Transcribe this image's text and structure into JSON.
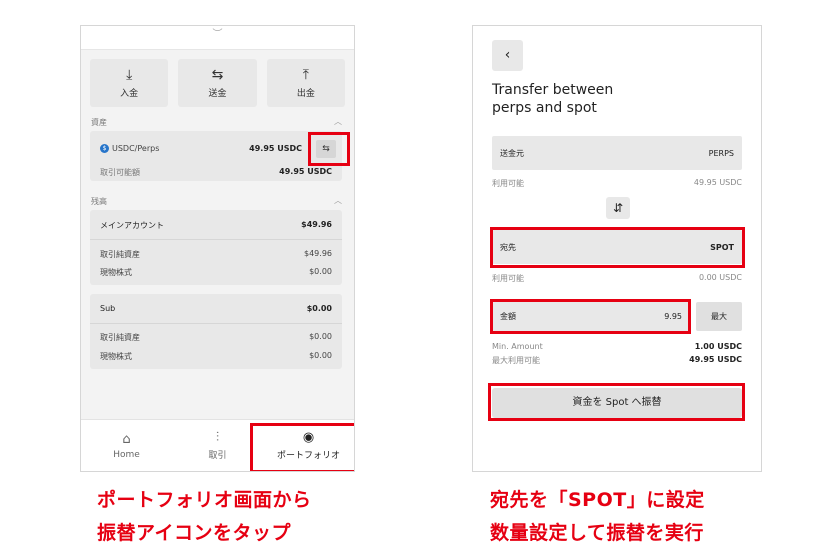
{
  "left": {
    "actions": [
      {
        "icon": "⤓",
        "label": "入金"
      },
      {
        "icon": "⇆",
        "label": "送金"
      },
      {
        "icon": "⤒",
        "label": "出金"
      }
    ],
    "assets_label": "資産",
    "asset_name": "USDC/Perps",
    "asset_value": "49.95 USDC",
    "tradable_label": "取引可能額",
    "tradable_value": "49.95 USDC",
    "balance_label": "残高",
    "main_account": {
      "name": "メインアカウント",
      "total": "$49.96",
      "rows": [
        {
          "label": "取引純資産",
          "value": "$49.96"
        },
        {
          "label": "現物株式",
          "value": "$0.00"
        }
      ]
    },
    "sub_account": {
      "name": "Sub",
      "total": "$0.00",
      "rows": [
        {
          "label": "取引純資産",
          "value": "$0.00"
        },
        {
          "label": "現物株式",
          "value": "$0.00"
        }
      ]
    },
    "nav": [
      {
        "icon": "⌂",
        "label": "Home"
      },
      {
        "icon": "⫶",
        "label": "取引"
      },
      {
        "icon": "◉",
        "label": "ポートフォリオ"
      }
    ]
  },
  "right": {
    "back_icon": "‹",
    "title_line1": "Transfer between",
    "title_line2": "perps and spot",
    "from_label": "送金元",
    "from_value": "PERPS",
    "from_available_label": "利用可能",
    "from_available_value": "49.95 USDC",
    "toggle_icon": "⇵",
    "to_label": "宛先",
    "to_value": "SPOT",
    "to_available_label": "利用可能",
    "to_available_value": "0.00 USDC",
    "amount_label": "金額",
    "amount_value": "9.95",
    "max_label": "最大",
    "min_amount_label": "Min. Amount",
    "min_amount_value": "1.00 USDC",
    "max_available_label": "最大利用可能",
    "max_available_value": "49.95 USDC",
    "submit_label": "資金を Spot へ振替"
  },
  "captions": {
    "left_line1": "ポートフォリオ画面から",
    "left_line2": "振替アイコンをタップ",
    "right_line1": "宛先を「SPOT」に設定",
    "right_line2": "数量設定して振替を実行"
  },
  "colors": {
    "highlight": "#e60012",
    "usdc": "#2775ca"
  }
}
